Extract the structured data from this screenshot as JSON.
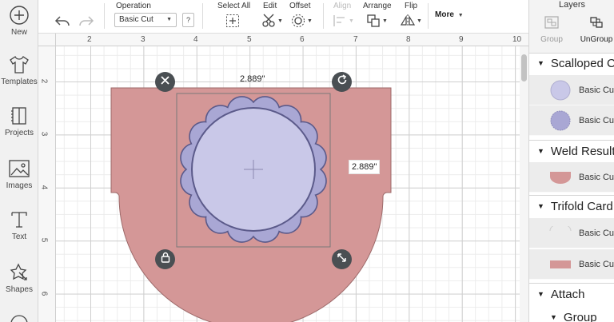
{
  "sidebar": {
    "items": [
      {
        "label": "New",
        "icon": "plus-circle-icon"
      },
      {
        "label": "Templates",
        "icon": "tshirt-icon"
      },
      {
        "label": "Projects",
        "icon": "projects-icon"
      },
      {
        "label": "Images",
        "icon": "image-icon"
      },
      {
        "label": "Text",
        "icon": "text-icon"
      },
      {
        "label": "Shapes",
        "icon": "shapes-icon"
      }
    ]
  },
  "toolbar": {
    "operation_label": "Operation",
    "operation_value": "Basic Cut",
    "help_label": "?",
    "select_all_label": "Select All",
    "edit_label": "Edit",
    "offset_label": "Offset",
    "align_label": "Align",
    "arrange_label": "Arrange",
    "flip_label": "Flip",
    "more_label": "More"
  },
  "ruler": {
    "top": [
      "2",
      "3",
      "4",
      "5",
      "6",
      "7",
      "8",
      "9",
      "10"
    ],
    "left": [
      "2",
      "3",
      "4",
      "5",
      "6"
    ]
  },
  "canvas": {
    "width_label": "2.889\"",
    "height_label": "2.889\"",
    "colors": {
      "card_fill": "#d49797",
      "card_stroke": "#9d6a6a",
      "scallop_fill": "#a9a7d4",
      "circle_fill": "#c9c8e8",
      "shape_stroke": "#5b5a8a",
      "handle": "#4a4f53"
    }
  },
  "layers": {
    "title": "Layers",
    "group_label": "Group",
    "ungroup_label": "UnGroup",
    "groups": [
      {
        "name": "Scalloped C",
        "rows": [
          {
            "label": "Basic Cu",
            "swatch": "#c9c8e8"
          },
          {
            "label": "Basic Cu",
            "swatch": "#a9a7d4"
          }
        ]
      },
      {
        "name": "Weld Result",
        "rows": [
          {
            "label": "Basic Cu",
            "swatch": "#d49797"
          }
        ]
      },
      {
        "name": "Trifold Card",
        "rows": [
          {
            "label": "Basic Cu",
            "swatch": "#ffffff"
          },
          {
            "label": "Basic Cu",
            "swatch": "#d49797"
          }
        ]
      },
      {
        "name": "Attach",
        "rows": []
      },
      {
        "name": "Group",
        "rows": []
      }
    ]
  }
}
